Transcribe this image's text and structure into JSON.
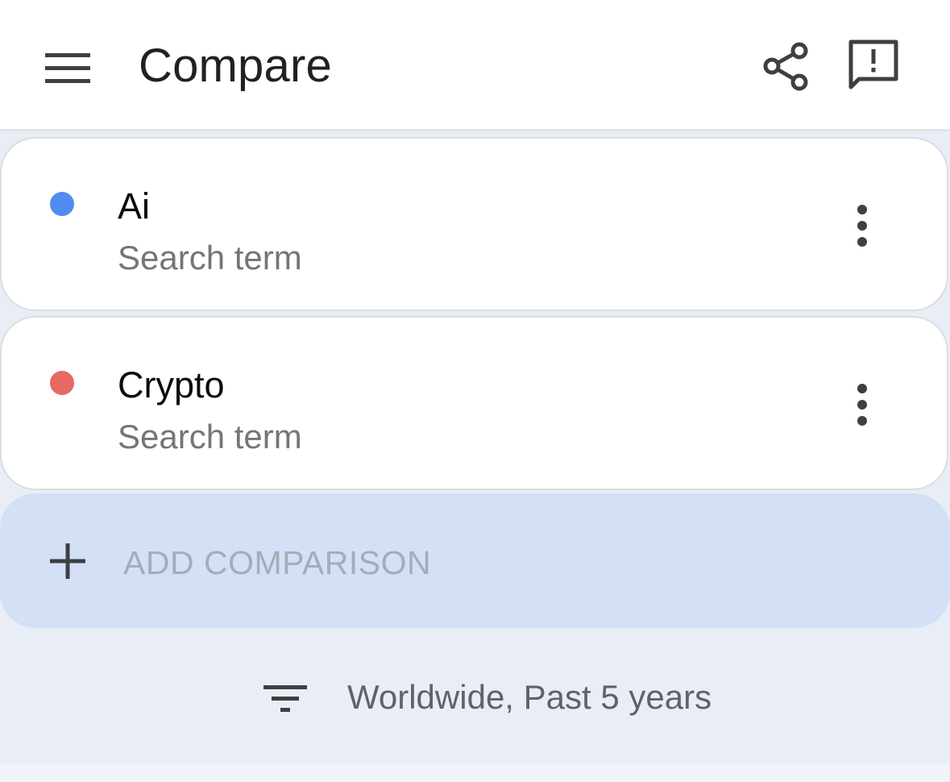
{
  "header": {
    "title": "Compare",
    "icons": [
      "menu-icon",
      "share-icon",
      "feedback-icon"
    ]
  },
  "comparisons": [
    {
      "name": "Ai",
      "type": "Search term",
      "color": "#4f8cf2"
    },
    {
      "name": "Crypto",
      "type": "Search term",
      "color": "#e66a61"
    }
  ],
  "add_comparison": {
    "label": "ADD COMPARISON",
    "icon": "plus-icon"
  },
  "filter": {
    "label": "Worldwide, Past 5 years",
    "icon": "filter-icon"
  },
  "colors": {
    "app_bar": "#ffffff",
    "content_bg": "#e9eef6",
    "add_row_bg": "#d3e0f5",
    "title_text": "#202124",
    "secondary_text": "#757575"
  }
}
